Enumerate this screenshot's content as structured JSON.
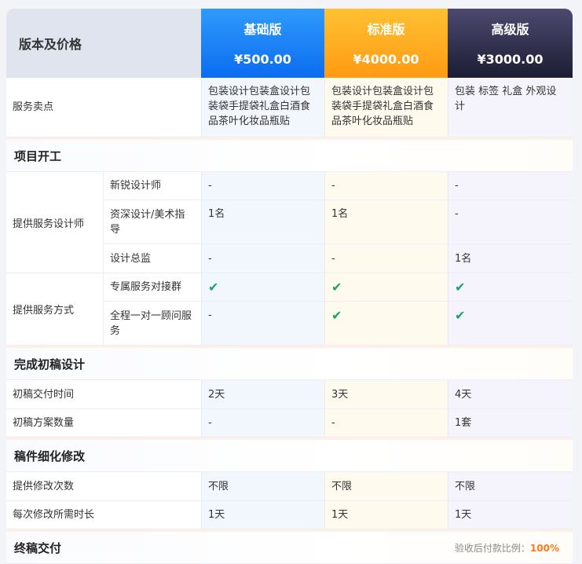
{
  "header": {
    "corner": "版本及价格",
    "plans": [
      {
        "name": "基础版",
        "price": "¥500.00"
      },
      {
        "name": "标准版",
        "price": "¥4000.00"
      },
      {
        "name": "高级版",
        "price": "¥3000.00"
      }
    ]
  },
  "selling": {
    "label": "服务卖点",
    "values": [
      "包装设计包装盒设计包装袋手提袋礼盒白酒食品茶叶化妆品瓶贴",
      "包装设计包装盒设计包装袋手提袋礼盒白酒食品茶叶化妆品瓶贴",
      "包装 标签 礼盒 外观设计"
    ]
  },
  "sections": {
    "s1": "项目开工",
    "s2": "完成初稿设计",
    "s3": "稿件细化修改",
    "s4": "终稿交付"
  },
  "designers": {
    "label": "提供服务设计师",
    "rows": [
      {
        "label": "新锐设计师",
        "values": [
          "-",
          "-",
          "-"
        ]
      },
      {
        "label": "资深设计/美术指导",
        "values": [
          "1名",
          "1名",
          "-"
        ]
      },
      {
        "label": "设计总监",
        "values": [
          "-",
          "-",
          "1名"
        ]
      }
    ]
  },
  "method": {
    "label": "提供服务方式",
    "check_symbol": "✔",
    "rows": [
      {
        "label": "专属服务对接群",
        "values": [
          "✔",
          "✔",
          "✔"
        ]
      },
      {
        "label": "全程一对一顾问服务",
        "values": [
          "-",
          "✔",
          "✔"
        ]
      }
    ]
  },
  "draft": {
    "rows": [
      {
        "label": "初稿交付时间",
        "values": [
          "2天",
          "3天",
          "4天"
        ]
      },
      {
        "label": "初稿方案数量",
        "values": [
          "-",
          "-",
          "1套"
        ]
      }
    ]
  },
  "revise": {
    "rows": [
      {
        "label": "提供修改次数",
        "values": [
          "不限",
          "不限",
          "不限"
        ]
      },
      {
        "label": "每次修改所需时长",
        "values": [
          "1天",
          "1天",
          "1天"
        ]
      }
    ]
  },
  "final": {
    "note_label": "验收后付款比例：",
    "note_value": "100%"
  }
}
